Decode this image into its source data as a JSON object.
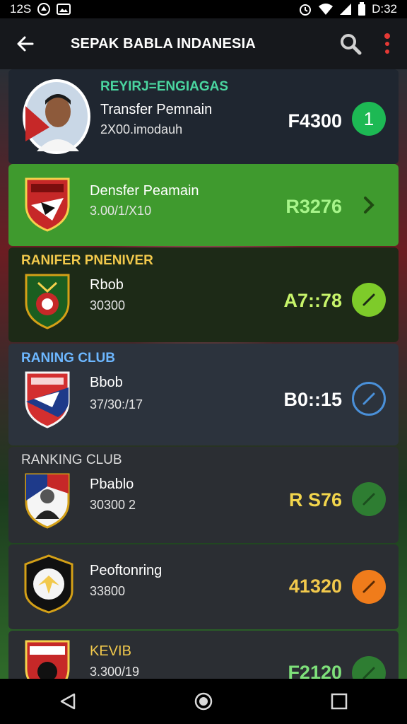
{
  "status_bar": {
    "time_left": "12S",
    "time_right": "D:32",
    "icons": [
      "vpn-icon",
      "picture-icon",
      "alarm-icon",
      "wifi-icon",
      "signal-icon",
      "battery-icon"
    ]
  },
  "app_bar": {
    "title": "SEPAK BABLA INDANESIA",
    "back_icon": "arrow-left-icon",
    "actions": [
      "search-icon",
      "more-vert-icon"
    ]
  },
  "cards": [
    {
      "header": "REYIRJ=ENGIAGAS",
      "name": "Transfer Pemnain",
      "sub": "2X00.imodauh",
      "price": "F4300",
      "action_text": "1",
      "action_color": "#1db954",
      "bg": "#1f2630",
      "header_color": "#4ad6a0",
      "price_color": "#ffffff",
      "badge": "player-photo"
    },
    {
      "header": "",
      "name": "Densfer Peamain",
      "sub": "3.00/1/X10",
      "price": "R3276",
      "action_icon": "chevron-right-icon",
      "action_color": "transparent",
      "bg": "#3f9a2e",
      "header_color": "#ffffff",
      "price_color": "#a7f58a",
      "badge": "crest-red-white"
    },
    {
      "header": "RANIFER PNENIVER",
      "name": "Rbob",
      "sub": "30300",
      "price": "A7::78",
      "action_icon": "pencil-icon",
      "action_color": "#7ecb2a",
      "bg": "#1d2a17",
      "header_color": "#f2c94c",
      "price_color": "#c7f46a",
      "badge": "crest-green-red"
    },
    {
      "header": "RANING CLUB",
      "name": "Bbob",
      "sub": "37/30:/17",
      "price": "B0::15",
      "action_icon": "pencil-icon",
      "action_color": "transparent",
      "action_border": "#4a90d9",
      "bg": "#2c333d",
      "header_color": "#6db7ff",
      "price_color": "#ffffff",
      "badge": "crest-red-blue"
    },
    {
      "header": "RANKING CLUB",
      "name": "Pbablo",
      "sub": "30300  2",
      "price": "R S76",
      "action_icon": "pencil-icon",
      "action_color": "#2e7d32",
      "bg": "#2b2e33",
      "header_color": "#dddddd",
      "price_color": "#f2d54c",
      "badge": "crest-portrait"
    },
    {
      "header": "",
      "name": "Peoftonring",
      "sub": "33800",
      "price": "41320",
      "action_icon": "pencil-icon",
      "action_color": "#f07c1b",
      "bg": "#2b2e33",
      "header_color": "#ffffff",
      "price_color": "#f2c94c",
      "badge": "crest-yellow-black"
    },
    {
      "header": "",
      "name": "KEVIB",
      "sub": "3.300/19",
      "price": "F2120",
      "action_icon": "pencil-icon",
      "action_color": "#2e7d32",
      "bg": "#2b2e33",
      "header_color": "#ffffff",
      "price_color": "#7ee07a",
      "badge": "crest-red-black",
      "name_color": "#f2c94c"
    }
  ],
  "nav_bar": {
    "buttons": [
      "back-triangle-icon",
      "home-circle-icon",
      "recents-square-icon"
    ]
  }
}
